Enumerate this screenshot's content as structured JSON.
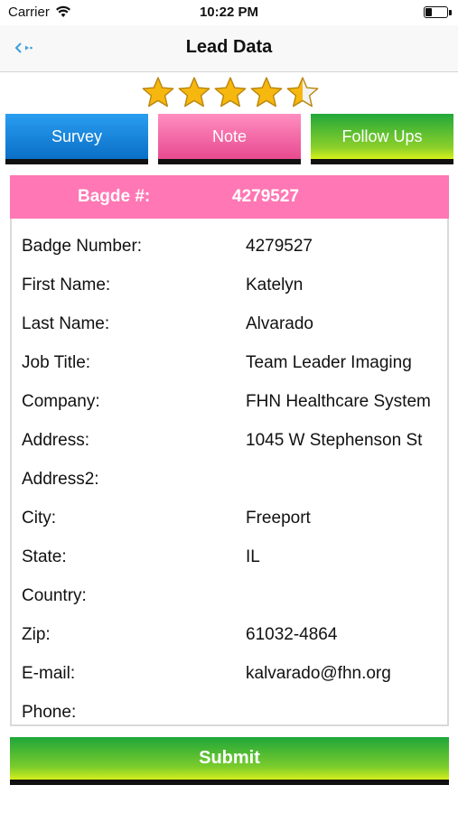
{
  "status_bar": {
    "carrier": "Carrier",
    "time": "10:22 PM"
  },
  "nav": {
    "title": "Lead Data",
    "back_icon": "back-arrow-icon"
  },
  "rating": {
    "value": 4.5,
    "max": 5
  },
  "tabs": [
    {
      "label": "Survey"
    },
    {
      "label": "Note"
    },
    {
      "label": "Follow Ups"
    }
  ],
  "badge": {
    "label": "Bagde #:",
    "value": "4279527"
  },
  "fields": [
    {
      "label": "Badge Number:",
      "value": "4279527"
    },
    {
      "label": "First Name:",
      "value": "Katelyn"
    },
    {
      "label": "Last Name:",
      "value": "Alvarado"
    },
    {
      "label": "Job Title:",
      "value": "Team Leader Imaging"
    },
    {
      "label": "Company:",
      "value": "FHN Healthcare System"
    },
    {
      "label": "Address:",
      "value": "1045 W Stephenson St"
    },
    {
      "label": "Address2:",
      "value": ""
    },
    {
      "label": "City:",
      "value": "Freeport"
    },
    {
      "label": "State:",
      "value": "IL"
    },
    {
      "label": "Country:",
      "value": ""
    },
    {
      "label": "Zip:",
      "value": "61032-4864"
    },
    {
      "label": "E-mail:",
      "value": "kalvarado@fhn.org"
    },
    {
      "label": "Phone:",
      "value": ""
    }
  ],
  "submit": {
    "label": "Submit"
  },
  "colors": {
    "survey": "#1589e0",
    "note": "#f46aa8",
    "follow_ups": "#4fbf2f",
    "badge_header": "#ff77b4",
    "submit": "#3fb534",
    "star": "#f6b70f"
  }
}
